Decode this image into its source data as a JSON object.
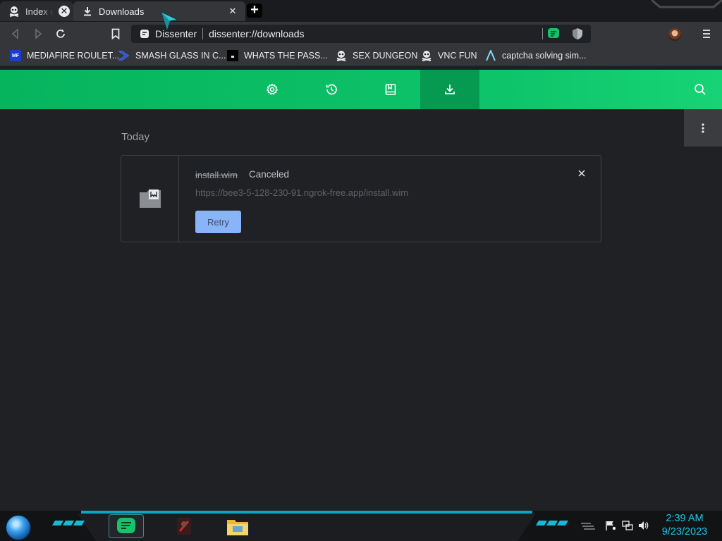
{
  "tabs": [
    {
      "label": "Index of",
      "close": "✕",
      "active": false
    },
    {
      "label": "Downloads",
      "close": "✕",
      "active": true
    }
  ],
  "new_tab": "+",
  "omnibox": {
    "site": "Dissenter",
    "url": "dissenter://downloads"
  },
  "bookmarks": [
    {
      "label": "MEDIAFIRE ROULET...",
      "icon": "mediafire-icon",
      "icon_text": "MF"
    },
    {
      "label": "SMASH GLASS IN C...",
      "icon": "smash-glass-icon"
    },
    {
      "label": "WHATS THE PASS...",
      "icon": "site-icon"
    },
    {
      "label": "SEX DUNGEON",
      "icon": "pirate-icon"
    },
    {
      "label": "VNC FUN",
      "icon": "pirate-icon"
    },
    {
      "label": "captcha solving sim...",
      "icon": "captcha-icon"
    }
  ],
  "downloads_nav": [
    "settings-icon",
    "history-icon",
    "bookmarks-icon",
    "downloads-icon",
    "search-icon"
  ],
  "section": "Today",
  "download": {
    "filename": "install.wim",
    "status": "Canceled",
    "url": "https://bee3-5-128-230-91.ngrok-free.app/install.wim",
    "retry_label": "Retry",
    "close": "✕"
  },
  "taskbar": {
    "time": "2:39 AM",
    "date": "9/23/2023"
  },
  "colors": {
    "accent_green": "#0ec46a",
    "active_green": "#059a50",
    "retry_blue": "#8ab4f8",
    "clock_cyan": "#19c7e6"
  }
}
